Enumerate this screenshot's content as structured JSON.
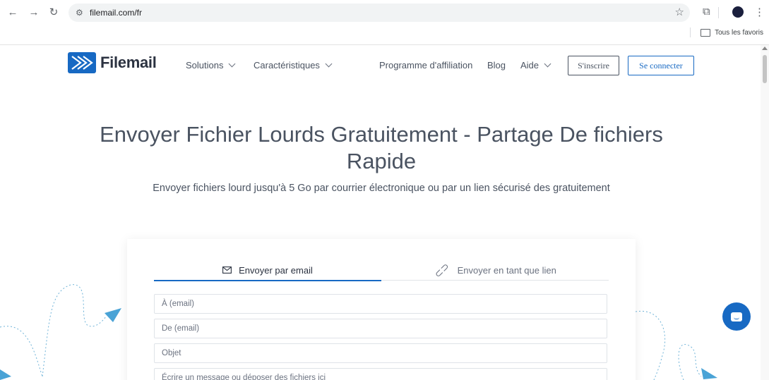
{
  "browser": {
    "url": "filemail.com/fr",
    "bookmarks_label": "Tous les favoris"
  },
  "nav": {
    "logo_text": "Filemail",
    "solutions": "Solutions",
    "features": "Caractéristiques",
    "affiliate": "Programme d'affiliation",
    "blog": "Blog",
    "help": "Aide",
    "signup": "S'inscrire",
    "login": "Se connecter"
  },
  "hero": {
    "title": "Envoyer Fichier Lourds Gratuitement - Partage De fichiers Rapide",
    "subtitle": "Envoyer fichiers lourd jusqu'à 5 Go par courrier électronique ou par un lien sécurisé des gratuitement"
  },
  "form": {
    "tab_email": "Envoyer par email",
    "tab_link": "Envoyer en tant que lien",
    "to_placeholder": "À (email)",
    "from_placeholder": "De (email)",
    "subject_placeholder": "Objet",
    "message_placeholder": "Écrire un message ou déposer des fichiers ici"
  },
  "colors": {
    "brand": "#1769c3",
    "text": "#4a5361",
    "decor": "#6fb3d8"
  }
}
